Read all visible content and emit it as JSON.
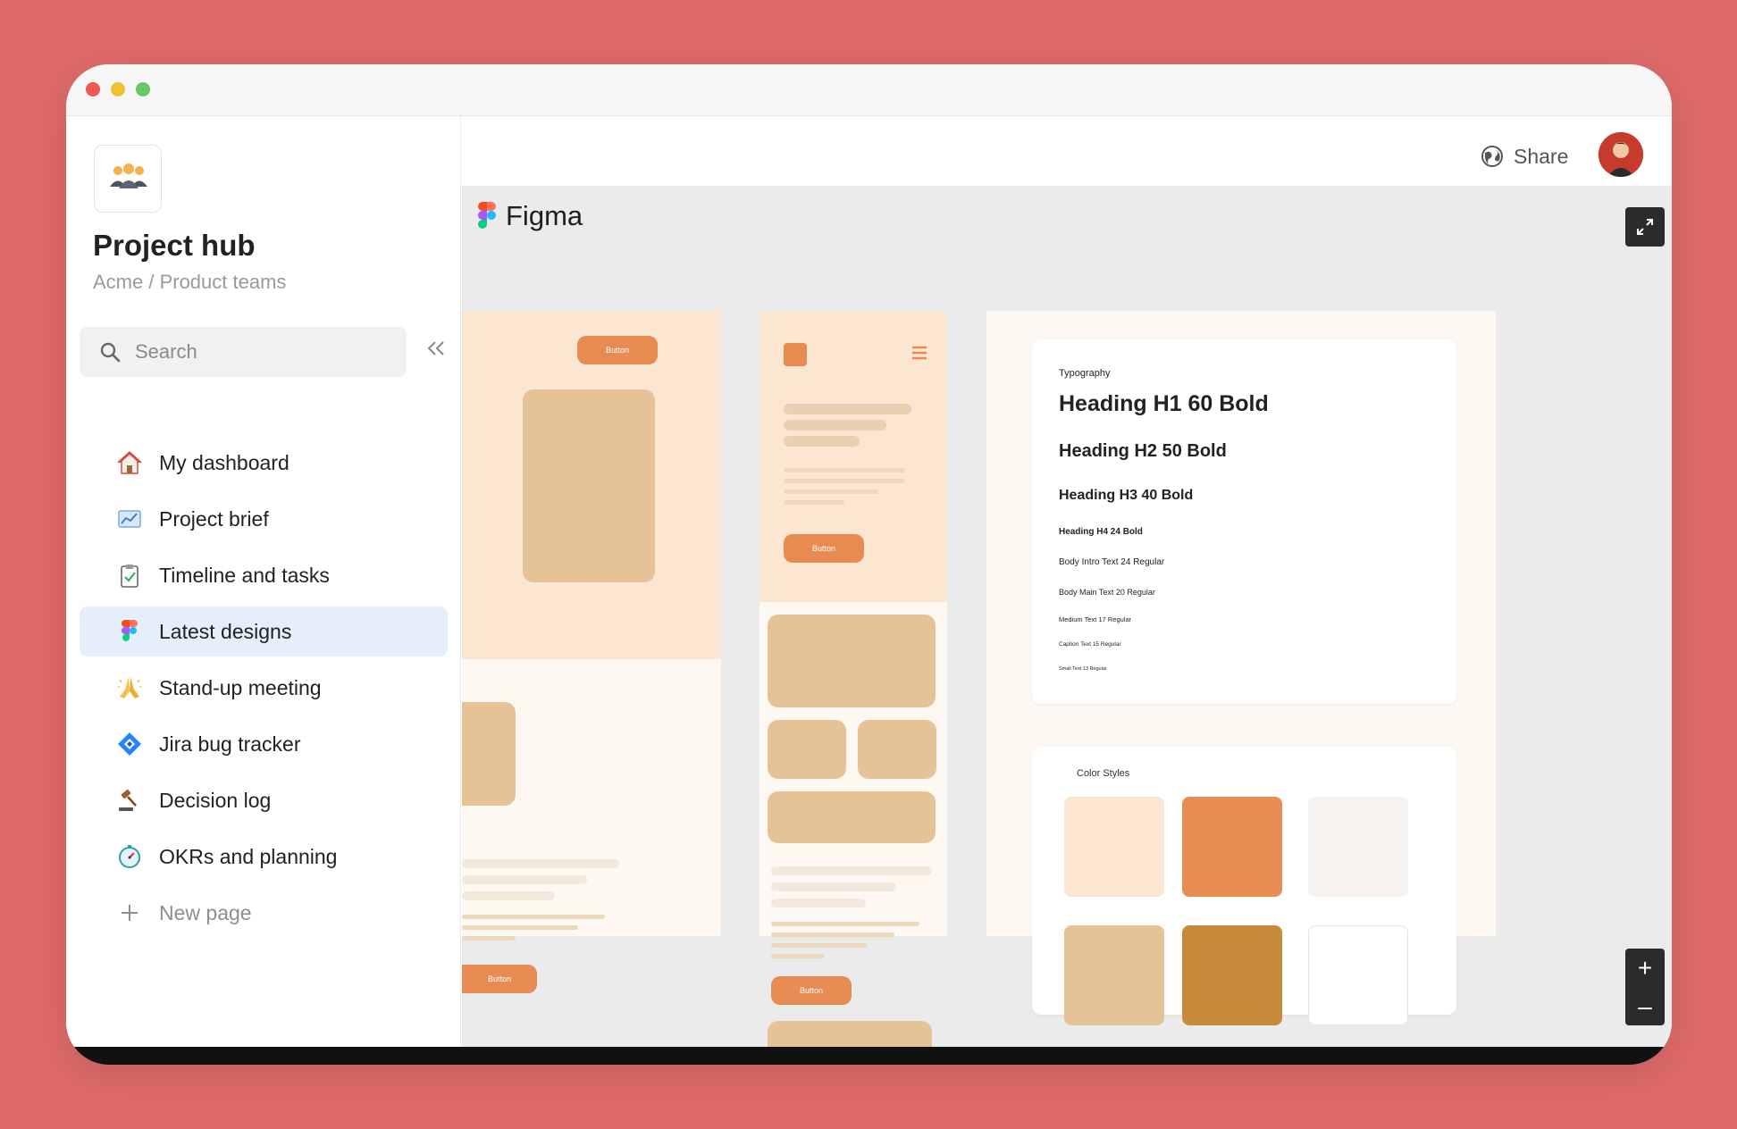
{
  "sidebar": {
    "title": "Project hub",
    "subtitle": "Acme / Product teams",
    "search_placeholder": "Search",
    "items": [
      {
        "label": "My dashboard",
        "icon": "house-icon"
      },
      {
        "label": "Project brief",
        "icon": "chart-icon"
      },
      {
        "label": "Timeline and tasks",
        "icon": "clipboard-icon"
      },
      {
        "label": "Latest designs",
        "icon": "figma-icon",
        "active": true
      },
      {
        "label": "Stand-up meeting",
        "icon": "praying-hands-icon"
      },
      {
        "label": "Jira bug tracker",
        "icon": "jira-icon"
      },
      {
        "label": "Decision log",
        "icon": "gavel-icon"
      },
      {
        "label": "OKRs and planning",
        "icon": "stopwatch-icon"
      }
    ],
    "new_page_label": "New page"
  },
  "header": {
    "share_label": "Share"
  },
  "embed": {
    "brand": "Figma"
  },
  "design": {
    "button_label": "Button",
    "typography": {
      "label": "Typography",
      "h1": "Heading H1 60 Bold",
      "h2": "Heading H2 50 Bold",
      "h3": "Heading H3 40 Bold",
      "h4": "Heading H4 24 Bold",
      "body_intro": "Body Intro Text 24 Regular",
      "body_main": "Body Main Text 20 Regular",
      "medium": "Medium Text 17 Regular",
      "caption": "Caption Text 15 Regular",
      "small": "Small Text 13 Regular"
    },
    "color_styles": {
      "label": "Color Styles",
      "swatches": [
        "#fbe6d1",
        "#e88c52",
        "#f5f2f0",
        "#e6c396",
        "#c88b3a",
        "#ffffff"
      ]
    }
  },
  "colors": {
    "background": "#de6a6a",
    "active_nav": "#e4eff9",
    "accent_orange": "#e78b52"
  }
}
